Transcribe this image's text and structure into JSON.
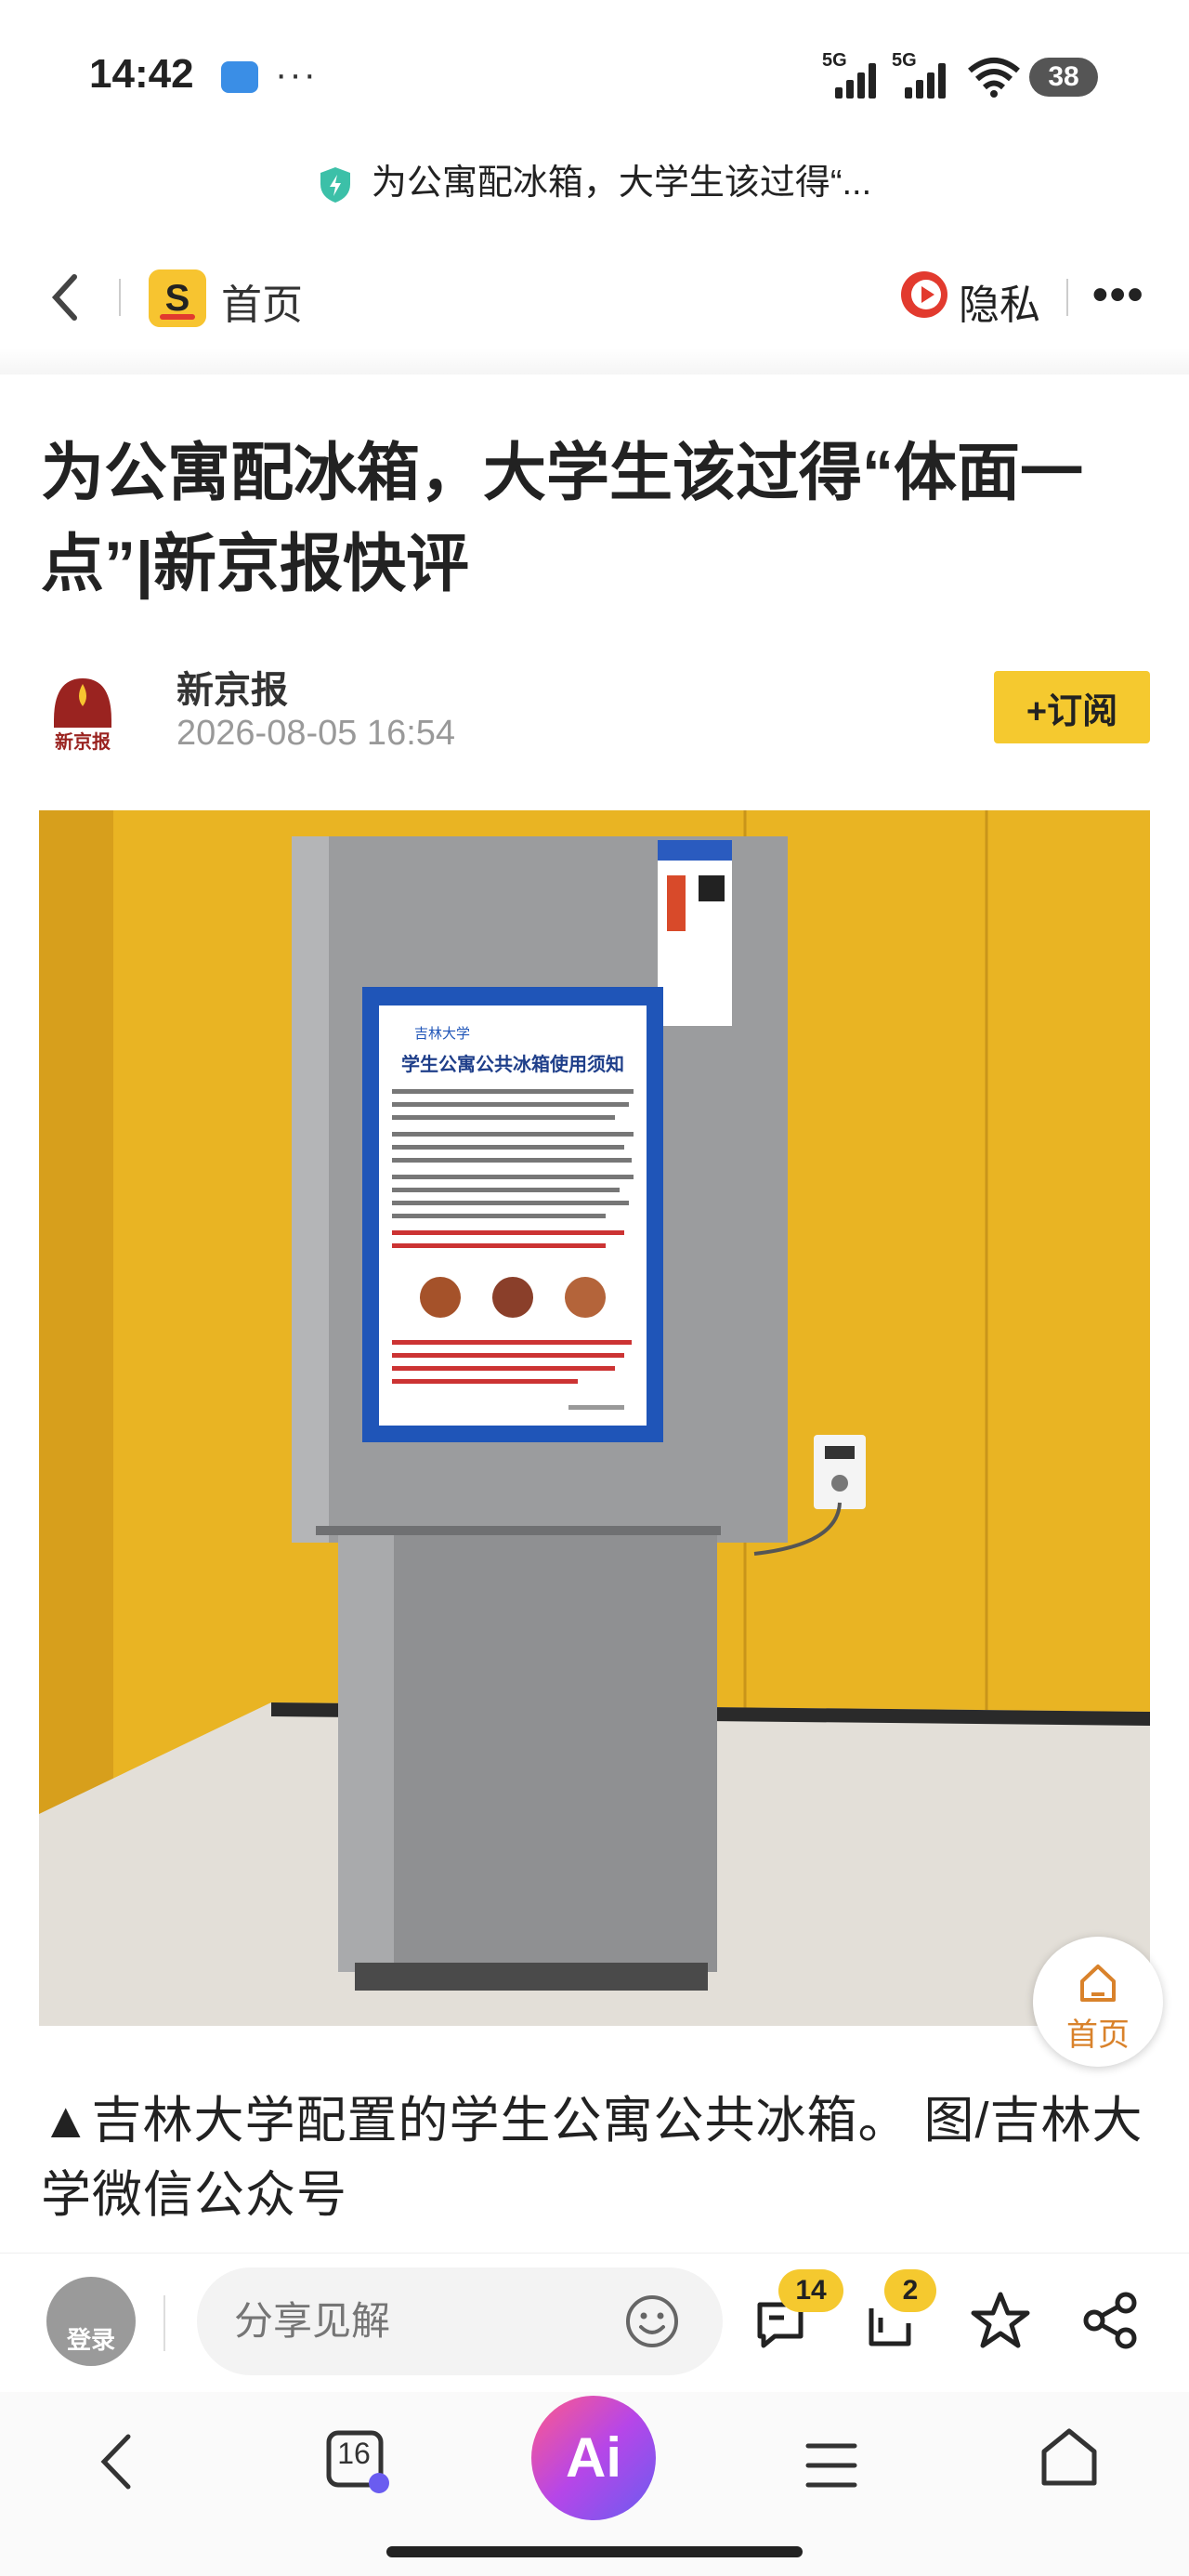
{
  "status_bar": {
    "time": "14:42",
    "more": "···",
    "signal_1": "5G",
    "signal_2": "5G",
    "battery": "38"
  },
  "url_bar": {
    "title": "为公寓配冰箱，大学生该过得“..."
  },
  "nav": {
    "home_label": "首页",
    "privacy_label": "隐私",
    "more": "•••"
  },
  "article": {
    "title": "为公寓配冰箱，大学生该过得“体面一点”|新京报快评",
    "author": "新京报",
    "avatar_text": "新京报",
    "date": "2026-08-05 16:54",
    "subscribe_label": "+订阅",
    "photo": {
      "notice_header": "吉林大学",
      "notice_title": "学生公寓公共冰箱使用须知"
    },
    "caption": "▲吉林大学配置的学生公寓公共冰箱。 图/吉林大学微信公众号"
  },
  "float_home": {
    "label": "首页"
  },
  "comment_bar": {
    "login_label": "登录",
    "share_placeholder": "分享见解",
    "comment_count": "14",
    "repost_count": "2"
  },
  "browser_bar": {
    "tab_count": "16",
    "ai_label": "Ai"
  },
  "colors": {
    "accent_yellow": "#f5c92f",
    "privacy_red": "#e23a2e",
    "wall_yellow": "#e9b423"
  }
}
